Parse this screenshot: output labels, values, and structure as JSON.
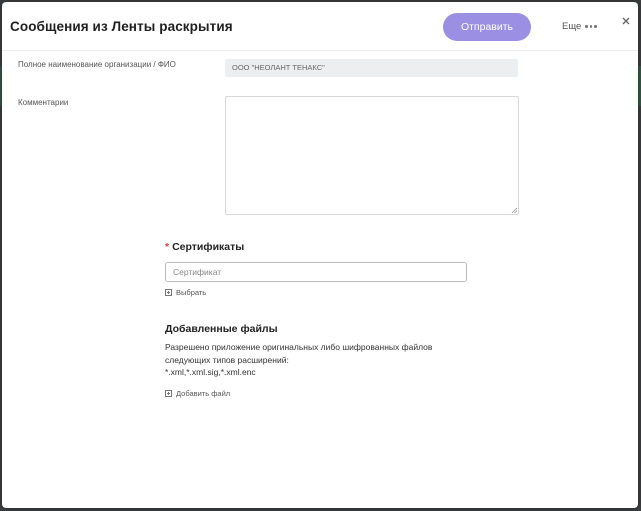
{
  "modal": {
    "title": "Сообщения из Ленты раскрытия",
    "send_label": "Отправить",
    "more_label": "Еще"
  },
  "form": {
    "org_label": "Полное наименование организации / ФИО",
    "org_value": "ООО \"НЕОЛАНТ ТЕНАКС\"",
    "comment_label": "Комментарии",
    "comment_value": ""
  },
  "certificates": {
    "title": "Сертификаты",
    "required_mark": "*",
    "placeholder": "Сертификат",
    "select_label": "Выбрать"
  },
  "files": {
    "title": "Добавленные файлы",
    "description_line1": "Разрешено приложение оригинальных либо шифрованных файлов",
    "description_line2": "следующих типов расширений:",
    "extensions": "*.xml,*.xml.sig,*.xml.enc",
    "add_label": "Добавить файл"
  },
  "colors": {
    "accent": "#9b8fe3",
    "required": "#d94040"
  },
  "icons": [
    "close-icon",
    "more-dots-icon",
    "plus-box-icon",
    "resize-grip-icon"
  ]
}
